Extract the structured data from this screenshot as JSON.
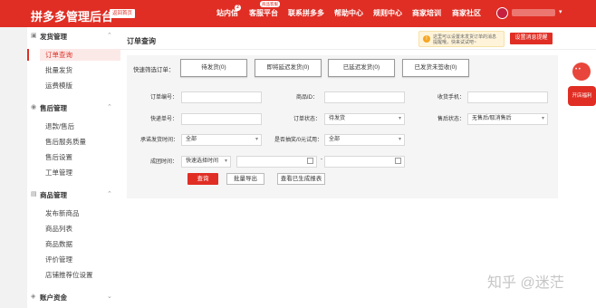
{
  "header": {
    "logo": "拼多多管理后台",
    "back_home": "返回首页",
    "nav": [
      "站内信",
      "客服平台",
      "联系拼多多",
      "帮助中心",
      "规则中心",
      "商家培训",
      "商家社区"
    ],
    "inbox_badge": "2",
    "service_tag": "商品客服",
    "accent_color": "#e02e24"
  },
  "sidebar": {
    "sections": [
      {
        "title": "发货管理",
        "icon": "box-icon",
        "items": [
          "订单查询",
          "批量发货",
          "运费模版"
        ]
      },
      {
        "title": "售后管理",
        "icon": "aftersale-icon",
        "items": [
          "退款/售后",
          "售后服务质量",
          "售后设置",
          "工单管理"
        ]
      },
      {
        "title": "商品管理",
        "icon": "goods-icon",
        "items": [
          "发布新商品",
          "商品列表",
          "商品数据",
          "评价管理",
          "店铺推荐位设置"
        ]
      },
      {
        "title": "账户资金",
        "icon": "wallet-icon",
        "items": []
      }
    ],
    "active_item": "订单查询"
  },
  "main": {
    "title": "订单查询",
    "tip": "这里可以设置未发货订单的消息提醒哦，快来试试吧~",
    "tip_button": "设置消息提醒",
    "quick_filter_label": "快速筛选订单：",
    "quick_filters": [
      "待发货(0)",
      "即将延迟发货(0)",
      "已延迟发货(0)",
      "已发货未签收(0)"
    ],
    "fields": {
      "order_no": "订单编号：",
      "goods_id": "商品ID：",
      "phone": "收货手机：",
      "tracking_no": "快递单号：",
      "order_status": "订单状态：",
      "order_status_value": "待发货",
      "aftersale_status": "售后状态：",
      "aftersale_status_value": "无售后/取消售后",
      "promised_ship": "承诺发货时间：",
      "promised_ship_value": "全部",
      "is_sample": "是否抽奖/0元试用：",
      "is_sample_value": "全部",
      "order_time": "成团时间：",
      "order_time_value": "快速选择时间",
      "range_dash": "-"
    },
    "buttons": {
      "query": "查询",
      "export": "批量导出",
      "view_reports": "查看已生成报表"
    }
  },
  "floating": {
    "promo_label": "开店福利"
  },
  "watermark": "知乎 @迷茫"
}
